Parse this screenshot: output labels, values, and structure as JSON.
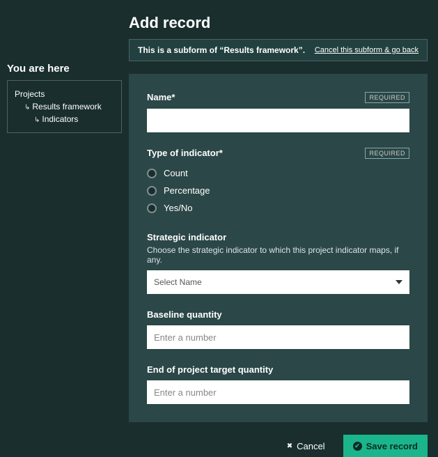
{
  "sidebar": {
    "heading": "You are here",
    "items": [
      {
        "label": "Projects",
        "indent": 0
      },
      {
        "label": "Results framework",
        "indent": 1
      },
      {
        "label": "Indicators",
        "indent": 2
      }
    ]
  },
  "header": {
    "title": "Add record",
    "subform_msg": "This is a subform of “Results framework”.",
    "cancel_link": "Cancel this subform & go back"
  },
  "form": {
    "name": {
      "label": "Name*",
      "required": "REQUIRED",
      "value": ""
    },
    "type": {
      "label": "Type of indicator*",
      "required": "REQUIRED",
      "options": [
        "Count",
        "Percentage",
        "Yes/No"
      ]
    },
    "strategic": {
      "label": "Strategic indicator",
      "helper": "Choose the strategic indicator to which this project indicator maps, if any.",
      "placeholder": "Select Name"
    },
    "baseline": {
      "label": "Baseline quantity",
      "placeholder": "Enter a number"
    },
    "target": {
      "label": "End of project target quantity",
      "placeholder": "Enter a number"
    }
  },
  "footer": {
    "cancel": "Cancel",
    "save": "Save record"
  }
}
